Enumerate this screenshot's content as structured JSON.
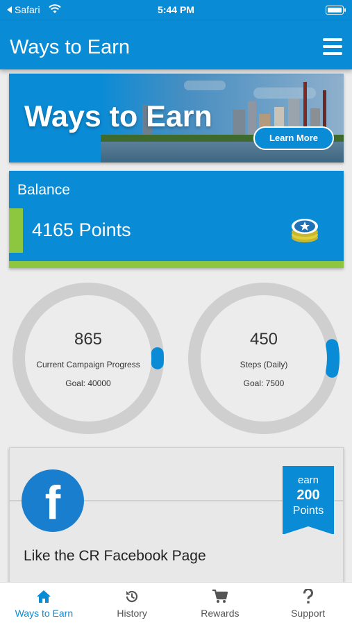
{
  "status_bar": {
    "back_label": "Safari",
    "time": "5:44 PM"
  },
  "header": {
    "title": "Ways to Earn"
  },
  "banner": {
    "title": "Ways to Earn",
    "button_label": "Learn More"
  },
  "balance": {
    "label": "Balance",
    "points": "4165 Points"
  },
  "progress_rings": [
    {
      "value": "865",
      "caption": "Current Campaign Progress",
      "goal": "Goal: 40000",
      "fraction": 0.022
    },
    {
      "value": "450",
      "caption": "Steps (Daily)",
      "goal": "Goal: 7500",
      "fraction": 0.06
    }
  ],
  "offer": {
    "earn_label": "earn",
    "amount": "200",
    "unit": "Points",
    "title": "Like the CR Facebook Page",
    "icon": "facebook-icon"
  },
  "tabs": [
    {
      "label": "Ways to Earn",
      "icon": "home-icon",
      "active": true
    },
    {
      "label": "History",
      "icon": "history-icon",
      "active": false
    },
    {
      "label": "Rewards",
      "icon": "cart-icon",
      "active": false
    },
    {
      "label": "Support",
      "icon": "question-icon",
      "active": false
    }
  ],
  "colors": {
    "primary": "#0a8bd6",
    "accent_green": "#8dc63f",
    "ring_track": "#cfcfcf",
    "background": "#ececec"
  }
}
